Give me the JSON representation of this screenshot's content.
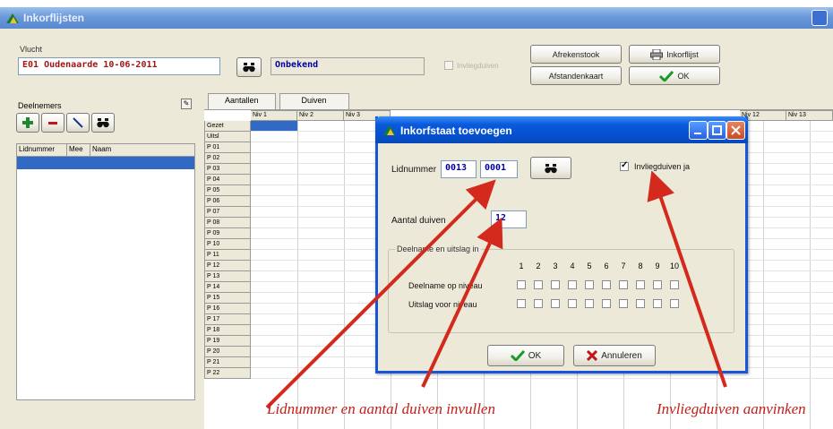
{
  "main_window": {
    "title": "Inkorflijsten"
  },
  "flight": {
    "label": "Vlucht",
    "value": "E01 Oudenaarde 10-06-2011",
    "unknown_value": "Onbekend",
    "invliegduiven_label": "Invliegduiven"
  },
  "toolbar": {
    "afrekenstook_label": "Afrekenstook",
    "inkorflijst_label": "Inkorflijst",
    "afstandenkaart_label": "Afstandenkaart",
    "ok_label": "OK"
  },
  "left_panel": {
    "tab_label": "Deelnemers",
    "columns": [
      "Lidnummer",
      "Mee",
      "Naam"
    ]
  },
  "grid": {
    "tabs": [
      "Aantallen",
      "Duiven"
    ],
    "column_headers": [
      "Niv 1",
      "Niv 2",
      "Niv 3",
      "Niv 12",
      "Niv 13"
    ],
    "row_headers": [
      "Gezet",
      "Uitsl",
      "P 01",
      "P 02",
      "P 03",
      "P 04",
      "P 05",
      "P 06",
      "P 07",
      "P 08",
      "P 09",
      "P 10",
      "P 11",
      "P 12",
      "P 13",
      "P 14",
      "P 15",
      "P 16",
      "P 17",
      "P 18",
      "P 19",
      "P 20",
      "P 21",
      "P 22"
    ]
  },
  "dialog": {
    "title": "Inkorfstaat toevoegen",
    "lidnummer_label": "Lidnummer",
    "lidnummer_part1": "0013",
    "lidnummer_part2": "0001",
    "invliegduiven_label": "Invliegduiven ja",
    "invliegduiven_checked": true,
    "aantal_label": "Aantal duiven",
    "aantal_value": "12",
    "group_title": "Deelname en uitslag in",
    "levels": [
      "1",
      "2",
      "3",
      "4",
      "5",
      "6",
      "7",
      "8",
      "9",
      "10"
    ],
    "deelname_label": "Deelname op niveau",
    "uitslag_label": "Uitslag voor niveau",
    "ok_label": "OK",
    "cancel_label": "Annuleren"
  },
  "annotations": {
    "left_text": "Lidnummer en aantal duiven invullen",
    "right_text": "Invliegduiven aanvinken",
    "arrow_color": "#d42a1e"
  },
  "colors": {
    "selection": "#316ac5",
    "xp_title": "#0a5adc",
    "window_bg": "#ece9d8",
    "flight_text": "#a01818",
    "unknown_text": "#0000a8"
  }
}
